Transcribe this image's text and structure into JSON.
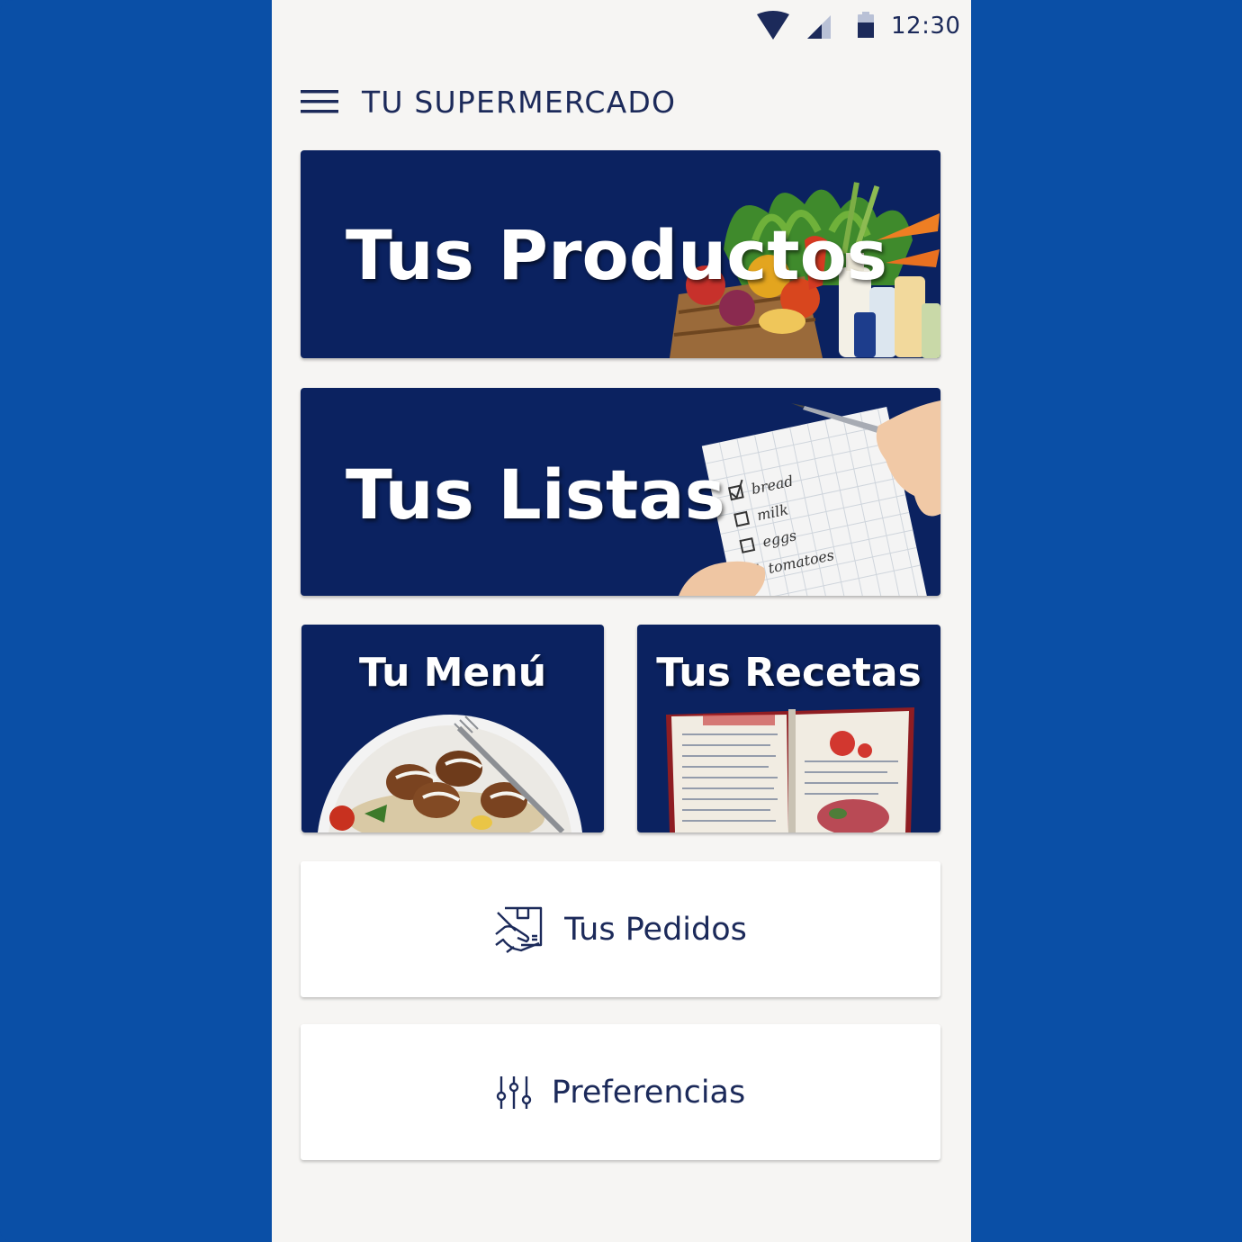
{
  "status_bar": {
    "time": "12:30",
    "icons": [
      "wifi-icon",
      "signal-icon",
      "battery-icon"
    ]
  },
  "app_bar": {
    "menu_icon": "hamburger-menu-icon",
    "title": "TU SUPERMERCADO"
  },
  "cards": {
    "productos": {
      "title": "Tus Productos"
    },
    "listas": {
      "title": "Tus Listas",
      "list_items": [
        "bread",
        "milk",
        "eggs",
        "tomatoes"
      ]
    },
    "menu": {
      "title": "Tu Menú"
    },
    "recetas": {
      "title": "Tus Recetas"
    }
  },
  "actions": {
    "pedidos": {
      "label": "Tus Pedidos",
      "icon": "package-delivery-icon"
    },
    "preferencias": {
      "label": "Preferencias",
      "icon": "sliders-icon"
    }
  },
  "colors": {
    "outer_background": "#0a4fa6",
    "phone_background": "#f6f5f3",
    "card_background": "#0b2260",
    "text_primary": "#1c2a5a"
  }
}
